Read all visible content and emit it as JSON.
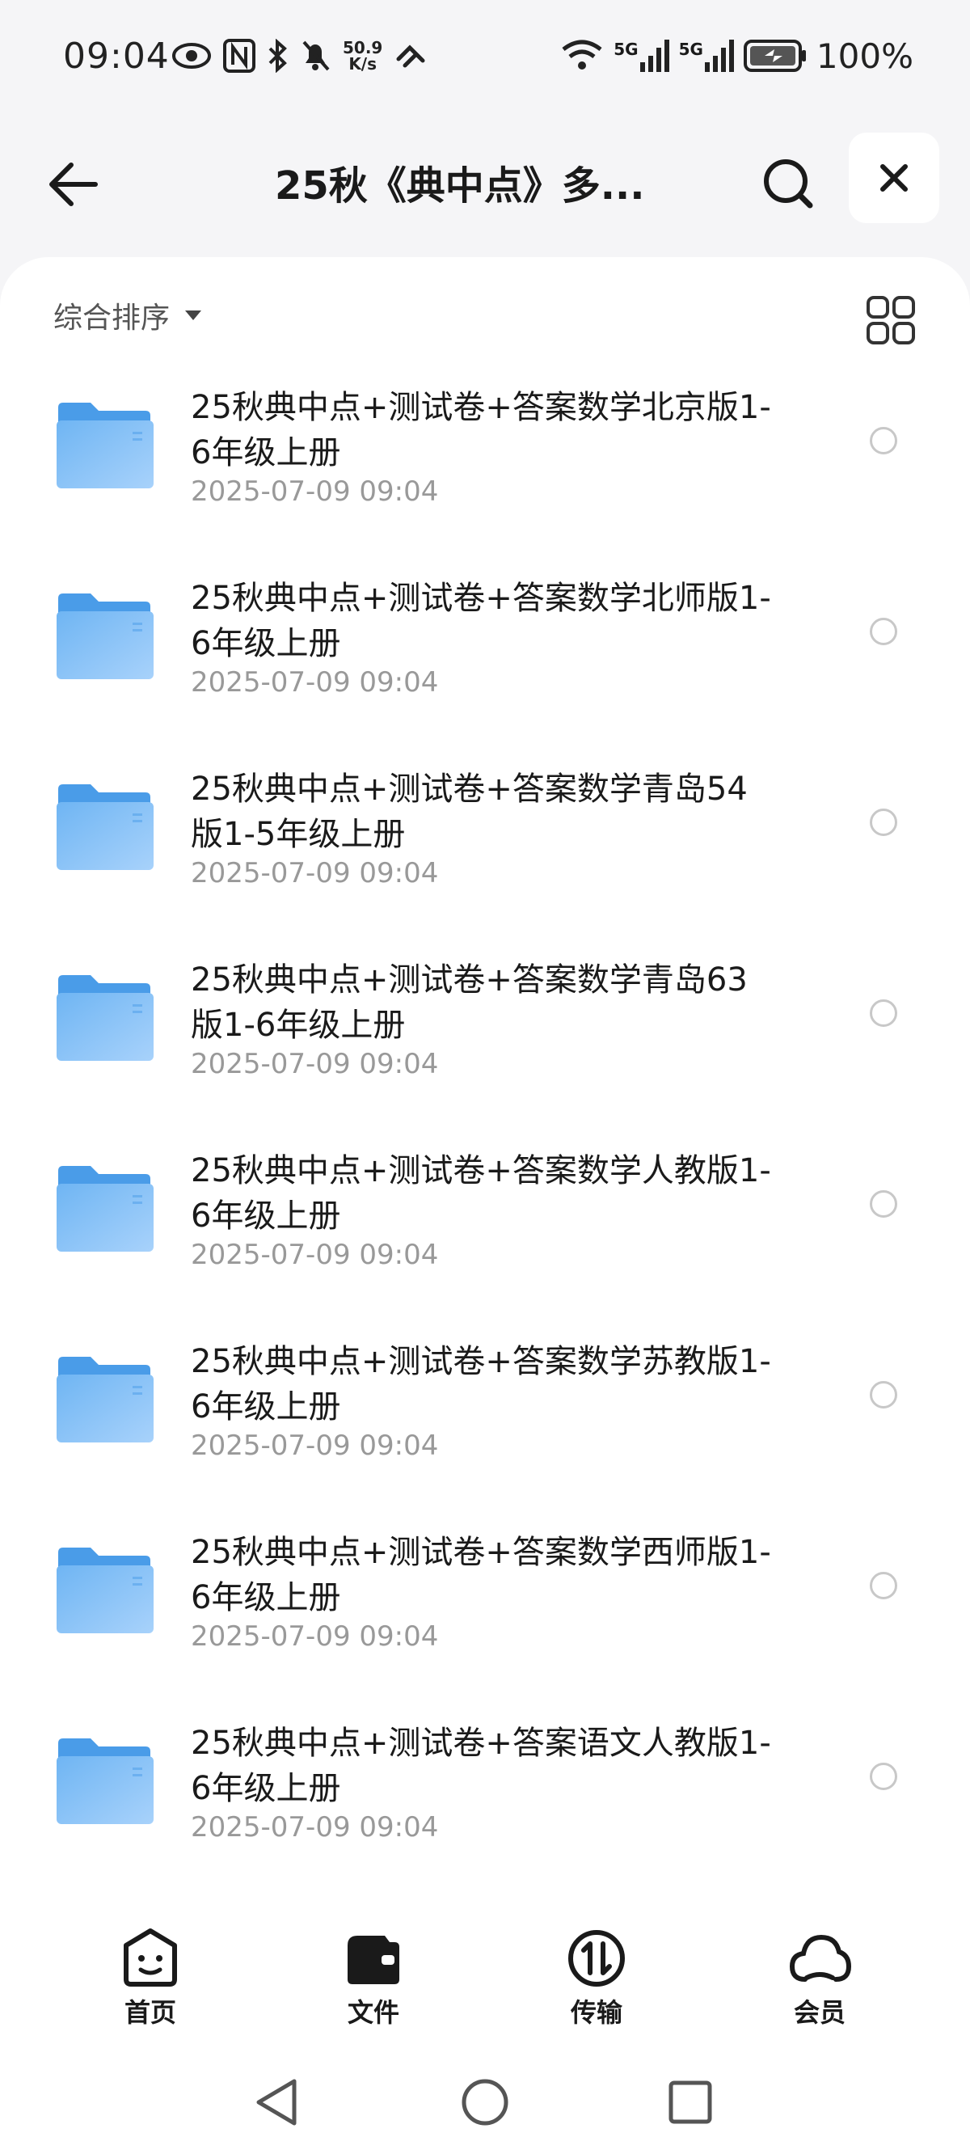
{
  "status_bar": {
    "time": "09:04",
    "speed_value": "50.9",
    "speed_unit": "K/s",
    "network_1": "5G",
    "network_2": "5G",
    "battery": "100%"
  },
  "header": {
    "title": "25秋《典中点》多..."
  },
  "toolbar": {
    "sort_label": "综合排序"
  },
  "files": [
    {
      "name": "25秋典中点+测试卷+答案数学北京版1-6年级上册",
      "date": "2025-07-09 09:04"
    },
    {
      "name": "25秋典中点+测试卷+答案数学北师版1-6年级上册",
      "date": "2025-07-09 09:04"
    },
    {
      "name": "25秋典中点+测试卷+答案数学青岛54版1-5年级上册",
      "date": "2025-07-09 09:04"
    },
    {
      "name": "25秋典中点+测试卷+答案数学青岛63版1-6年级上册",
      "date": "2025-07-09 09:04"
    },
    {
      "name": "25秋典中点+测试卷+答案数学人教版1-6年级上册",
      "date": "2025-07-09 09:04"
    },
    {
      "name": "25秋典中点+测试卷+答案数学苏教版1-6年级上册",
      "date": "2025-07-09 09:04"
    },
    {
      "name": "25秋典中点+测试卷+答案数学西师版1-6年级上册",
      "date": "2025-07-09 09:04"
    },
    {
      "name": "25秋典中点+测试卷+答案语文人教版1-6年级上册",
      "date": "2025-07-09 09:04"
    }
  ],
  "bottom_nav": {
    "home": "首页",
    "files": "文件",
    "transfer": "传输",
    "member": "会员"
  },
  "colors": {
    "folder_blue": "#5aa9f0",
    "accent_dark": "#1a1a1a"
  }
}
